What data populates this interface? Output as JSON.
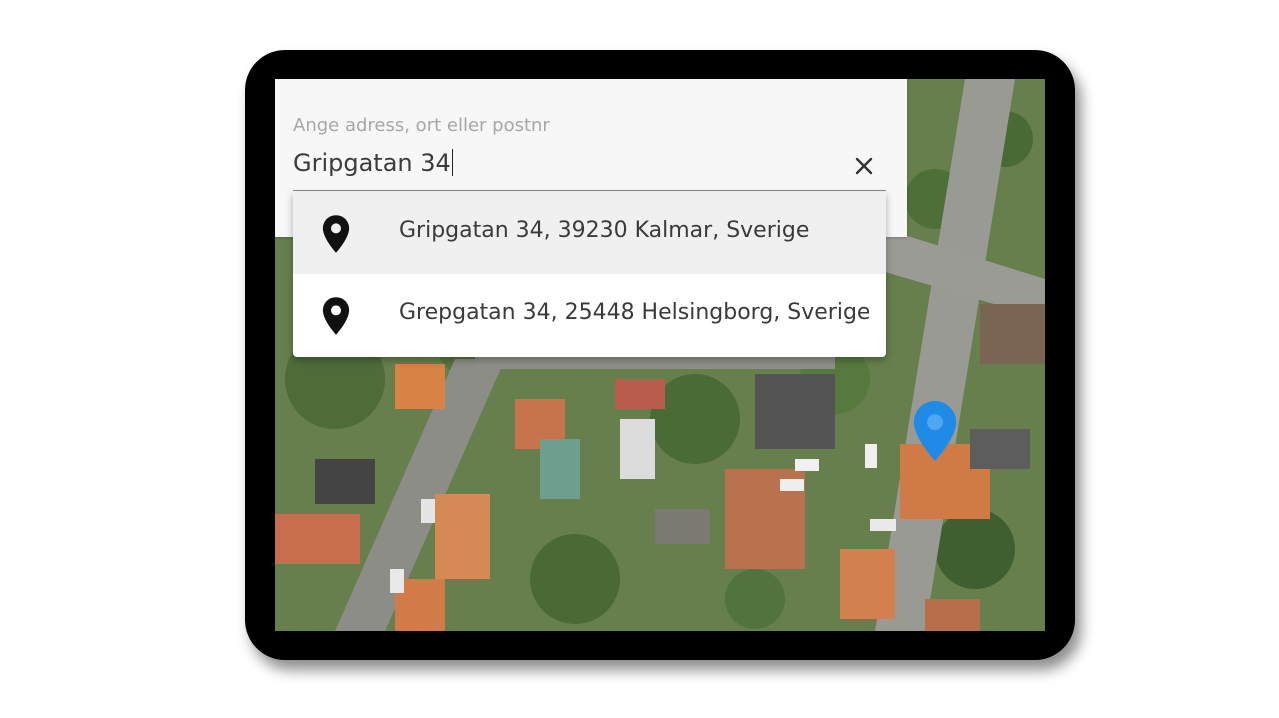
{
  "search": {
    "label": "Ange adress, ort eller postnr",
    "value": "Gripgatan 34",
    "clear_icon": "close-icon"
  },
  "suggestions": [
    {
      "icon": "location-pin-icon",
      "label": "Gripgatan 34, 39230 Kalmar, Sverige",
      "highlighted": true
    },
    {
      "icon": "location-pin-icon",
      "label": "Grepgatan 34, 25448 Helsingborg, Sverige",
      "highlighted": false
    }
  ],
  "map": {
    "type": "satellite",
    "marker_icon": "map-marker-icon",
    "marker_color": "#1f8be6"
  },
  "colors": {
    "panel_bg": "#f7f7f7",
    "highlight_bg": "#f0f0f0",
    "device_frame": "#000000"
  }
}
